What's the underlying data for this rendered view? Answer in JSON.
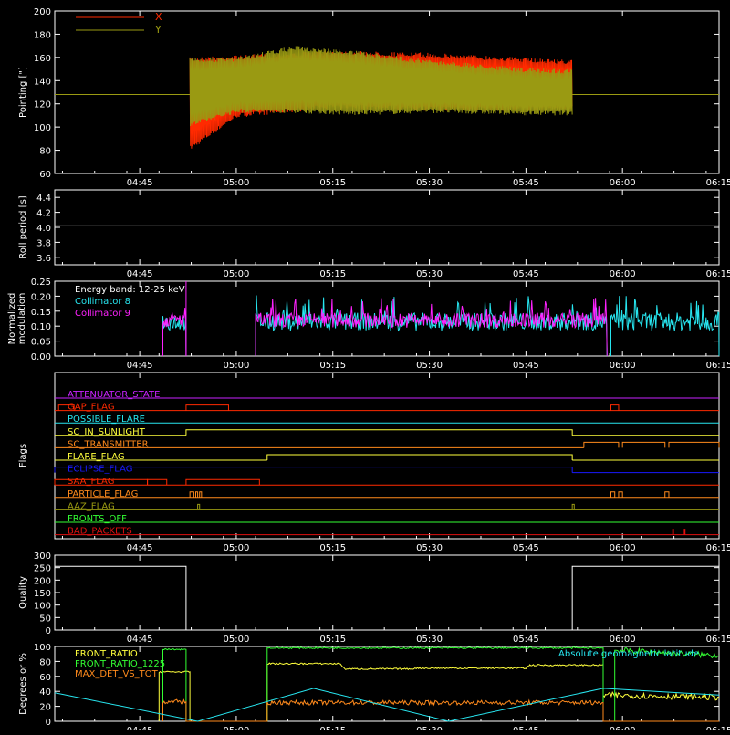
{
  "colors": {
    "background": "#000000",
    "axis": "#ffffff",
    "red": "#ff2a00",
    "olive": "#9a9a12",
    "cyan": "#27e6f0",
    "magenta": "#ff22ff",
    "yellow": "#ffff3c",
    "green": "#33ff33",
    "orange": "#ff8a1c",
    "blue": "#1a1aff",
    "purple": "#c822ff",
    "darkred": "#e01010",
    "salmon": "#ff6644"
  },
  "chart_data": [
    {
      "id": "pointing",
      "type": "line",
      "ylabel": "Pointing [\"]",
      "ylim": [
        60,
        200
      ],
      "yticks": [
        60,
        80,
        100,
        120,
        140,
        160,
        180,
        200
      ],
      "xtick_labels": [
        "04:45",
        "05:00",
        "05:15",
        "05:30",
        "05:45",
        "06:00",
        "06:15"
      ],
      "legend": [
        "X",
        "Y"
      ],
      "series": [
        {
          "name": "X",
          "color": "#ff2a00",
          "upper": [
            [
              4.87,
              128
            ],
            [
              4.88,
              160
            ],
            [
              5.0,
              162
            ],
            [
              5.25,
              166
            ],
            [
              5.5,
              164
            ],
            [
              5.75,
              160
            ],
            [
              5.87,
              158
            ]
          ],
          "lower": [
            [
              4.87,
              128
            ],
            [
              4.88,
              80
            ],
            [
              5.0,
              108
            ],
            [
              5.25,
              116
            ],
            [
              5.5,
              114
            ],
            [
              5.75,
              114
            ],
            [
              5.87,
              116
            ]
          ],
          "baseline": 128
        },
        {
          "name": "Y",
          "color": "#9a9a12",
          "upper": [
            [
              4.87,
              128
            ],
            [
              4.88,
              160
            ],
            [
              5.0,
              160
            ],
            [
              5.15,
              170
            ],
            [
              5.3,
              166
            ],
            [
              5.5,
              158
            ],
            [
              5.75,
              151
            ],
            [
              5.87,
              150
            ]
          ],
          "lower": [
            [
              4.87,
              128
            ],
            [
              4.88,
              100
            ],
            [
              5.0,
              112
            ],
            [
              5.15,
              112
            ],
            [
              5.3,
              110
            ],
            [
              5.5,
              112
            ],
            [
              5.75,
              110
            ],
            [
              5.87,
              110
            ]
          ],
          "baseline": 128
        }
      ]
    },
    {
      "id": "roll",
      "type": "line",
      "ylabel": "Roll period [s]",
      "ylim": [
        3.5,
        4.5
      ],
      "yticks": [
        3.6,
        3.8,
        4.0,
        4.2,
        4.4
      ],
      "ytick_labels": [
        "3.6",
        "3.8",
        "4.0",
        "4.2",
        "4.4"
      ],
      "xtick_labels": [
        "04:45",
        "05:00",
        "05:15",
        "05:30",
        "05:45",
        "06:00",
        "06:15"
      ],
      "series": [
        {
          "name": "",
          "color": "#ffffff",
          "x": [
            4.53,
            6.25
          ],
          "y": [
            4.02,
            4.02
          ]
        }
      ]
    },
    {
      "id": "modulation",
      "type": "line",
      "ylabel": "Normalized modulation",
      "ylim": [
        0,
        0.25
      ],
      "yticks": [
        0,
        0.05,
        0.1,
        0.15,
        0.2,
        0.25
      ],
      "ytick_labels": [
        "0.00",
        "0.05",
        "0.10",
        "0.15",
        "0.20",
        "0.25"
      ],
      "xtick_labels": [
        "04:45",
        "05:00",
        "05:15",
        "05:30",
        "05:45",
        "06:00",
        "06:15"
      ],
      "annotations": [
        "Energy band: 12-25 keV"
      ],
      "legend": [
        "Collimator 8",
        "Collimator 9"
      ],
      "segments": [
        [
          4.81,
          4.87
        ],
        [
          5.05,
          5.96
        ],
        [
          5.97,
          6.25
        ]
      ],
      "series": [
        {
          "name": "Collimator 8",
          "color": "#27e6f0",
          "mean": 0.115,
          "spread": 0.03
        },
        {
          "name": "Collimator 9",
          "color": "#ff22ff",
          "mean": 0.12,
          "spread": 0.025
        }
      ]
    },
    {
      "id": "flags",
      "type": "line",
      "ylabel": "Flags",
      "xtick_labels": [
        "04:45",
        "05:00",
        "05:15",
        "05:30",
        "05:45",
        "06:00",
        "06:15"
      ],
      "series": [
        {
          "name": "ATTENUATOR_STATE",
          "color": "#c822ff",
          "low": [
            [
              4.53,
              6.25
            ]
          ],
          "high": []
        },
        {
          "name": "GAP_FLAG",
          "color": "#ff2a00",
          "low": [
            [
              4.53,
              6.25
            ]
          ],
          "high": [
            [
              4.54,
              4.58
            ],
            [
              4.87,
              4.98
            ],
            [
              5.97,
              5.99
            ]
          ]
        },
        {
          "name": "POSSIBLE_FLARE",
          "color": "#27e6f0",
          "low": [
            [
              4.53,
              6.25
            ]
          ],
          "high": []
        },
        {
          "name": "SC_IN_SUNLIGHT",
          "color": "#ffff3c",
          "low": [
            [
              4.53,
              4.87
            ],
            [
              5.87,
              6.25
            ]
          ],
          "high": [
            [
              4.87,
              5.87
            ]
          ]
        },
        {
          "name": "SC_TRANSMITTER",
          "color": "#ff8a1c",
          "low": [
            [
              4.53,
              5.9
            ]
          ],
          "high": [
            [
              5.9,
              5.99
            ],
            [
              6.0,
              6.11
            ],
            [
              6.12,
              6.25
            ]
          ]
        },
        {
          "name": "FLARE_FLAG",
          "color": "#ffff3c",
          "low": [
            [
              4.53,
              5.08
            ],
            [
              5.87,
              6.25
            ]
          ],
          "high": [
            [
              5.08,
              5.87
            ]
          ]
        },
        {
          "name": "ECLIPSE_FLAG",
          "color": "#1a1aff",
          "low": [
            [
              5.87,
              6.25
            ]
          ],
          "high": [
            [
              4.53,
              5.87
            ]
          ]
        },
        {
          "name": "SAA_FLAG",
          "color": "#ff2a00",
          "low": [
            [
              4.53,
              6.25
            ]
          ],
          "high": [
            [
              4.53,
              4.77
            ],
            [
              4.77,
              4.82
            ],
            [
              4.87,
              5.06
            ]
          ]
        },
        {
          "name": "PARTICLE_FLAG",
          "color": "#ff8a1c",
          "low": [
            [
              4.53,
              6.25
            ]
          ],
          "high": [
            [
              4.88,
              4.89
            ],
            [
              4.895,
              4.9
            ],
            [
              4.905,
              4.91
            ],
            [
              5.97,
              5.98
            ],
            [
              5.99,
              6.0
            ],
            [
              6.11,
              6.12
            ]
          ]
        },
        {
          "name": "AAZ_FLAG",
          "color": "#9a9a12",
          "low": [
            [
              4.53,
              6.25
            ]
          ],
          "high": [
            [
              4.9,
              4.905
            ],
            [
              5.87,
              5.875
            ]
          ]
        },
        {
          "name": "FRONTS_OFF",
          "color": "#33ff33",
          "low": [
            [
              4.53,
              6.25
            ]
          ],
          "high": []
        },
        {
          "name": "BAD_PACKETS",
          "color": "#e01010",
          "low": [
            [
              4.53,
              6.25
            ]
          ],
          "high": [
            [
              6.13,
              6.132
            ],
            [
              6.16,
              6.162
            ]
          ]
        }
      ]
    },
    {
      "id": "quality",
      "type": "line",
      "ylabel": "Quality",
      "ylim": [
        0,
        300
      ],
      "yticks": [
        0,
        50,
        100,
        150,
        200,
        250,
        300
      ],
      "xtick_labels": [
        "04:45",
        "05:00",
        "05:15",
        "05:30",
        "05:45",
        "06:00",
        "06:15"
      ],
      "series": [
        {
          "name": "",
          "color": "#ffffff",
          "x": [
            4.53,
            4.87,
            4.87,
            5.87,
            5.87,
            6.25
          ],
          "y": [
            255,
            255,
            0,
            0,
            255,
            255
          ]
        }
      ]
    },
    {
      "id": "ratios",
      "type": "line",
      "ylabel": "Degrees or %",
      "ylim": [
        0,
        100
      ],
      "yticks": [
        0,
        20,
        40,
        60,
        80,
        100
      ],
      "xtick_labels": [
        "04:45",
        "05:00",
        "05:15",
        "05:30",
        "05:45",
        "06:00",
        "06:15"
      ],
      "legend": [
        "FRONT_RATIO",
        "FRONT_RATIO_1225",
        "MAX_DET_VS_TOT",
        "Absolute geomagnetic latitude"
      ],
      "series": [
        {
          "name": "FRONT_RATIO",
          "color": "#ffff3c",
          "x": [
            4.8,
            4.8,
            4.88,
            4.88,
            5.08,
            5.08,
            5.27,
            5.28,
            5.46,
            5.46,
            5.75,
            5.76,
            5.95,
            5.95,
            6.25
          ],
          "y": [
            0,
            66,
            66,
            0,
            0,
            77,
            77,
            70,
            70,
            71,
            71,
            75,
            75,
            35,
            32
          ]
        },
        {
          "name": "FRONT_RATIO_1225",
          "color": "#33ff33",
          "x": [
            4.81,
            4.81,
            4.87,
            4.87,
            5.08,
            5.08,
            5.95,
            5.95,
            5.98,
            5.98,
            6.25
          ],
          "y": [
            0,
            96,
            96,
            0,
            0,
            98,
            98,
            0,
            0,
            95,
            88
          ]
        },
        {
          "name": "MAX_DET_VS_TOT",
          "color": "#ff8a1c",
          "x": [
            4.81,
            4.81,
            4.87,
            4.87,
            5.08,
            5.08,
            5.95,
            5.95,
            6.25
          ],
          "y": [
            0,
            26,
            26,
            0,
            0,
            25,
            25,
            0,
            0
          ]
        },
        {
          "name": "Absolute geomagnetic latitude",
          "color": "#27e6f0",
          "x": [
            4.53,
            4.9,
            5.2,
            5.55,
            5.95,
            6.25
          ],
          "y": [
            38,
            0,
            44,
            0,
            44,
            35
          ]
        }
      ]
    }
  ]
}
